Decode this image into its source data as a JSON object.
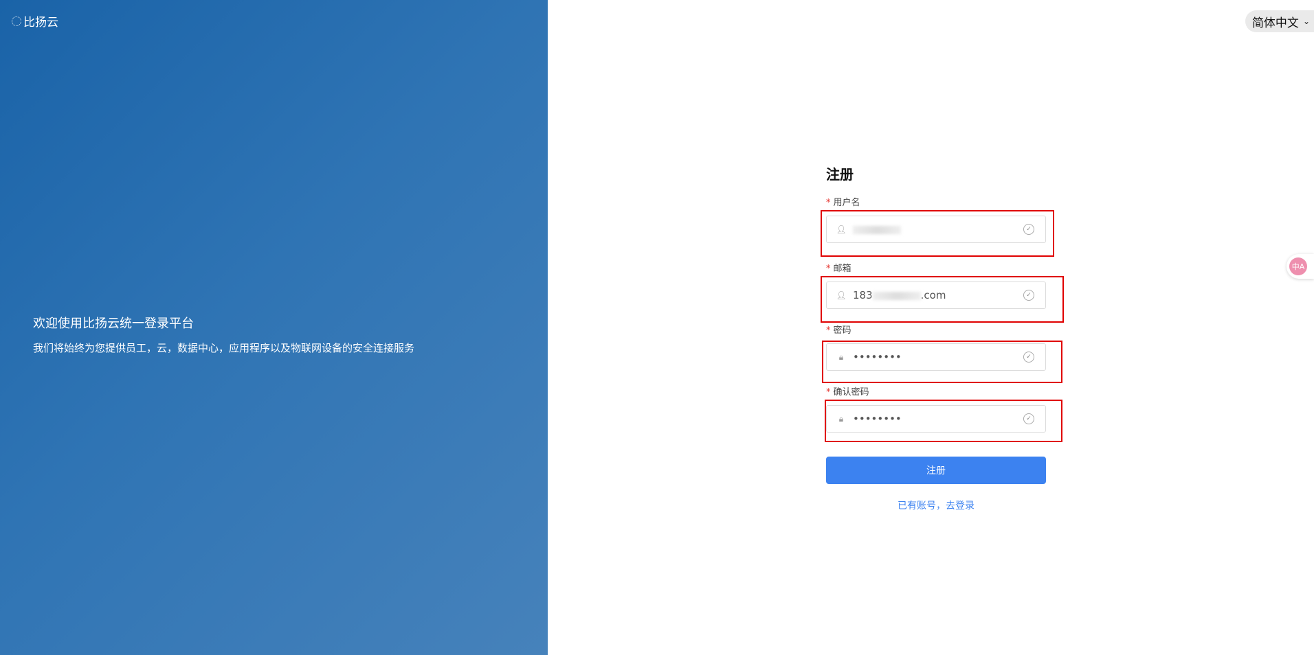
{
  "brand": {
    "name": "比扬云",
    "icon": "loading-dots-icon"
  },
  "hero": {
    "title": "欢迎使用比扬云统一登录平台",
    "subtitle": "我们将始终为您提供员工，云，数据中心，应用程序以及物联网设备的安全连接服务"
  },
  "language": {
    "selected": "简体中文"
  },
  "translate_widget": {
    "icon": "translate-icon",
    "text": "中A"
  },
  "form": {
    "title": "注册",
    "required_mark": "*",
    "fields": [
      {
        "label": "用户名",
        "value": "",
        "icon": "user-icon"
      },
      {
        "label": "邮箱",
        "value_prefix": "183",
        "value_suffix": ".com",
        "icon": "user-icon"
      },
      {
        "label": "密码",
        "value": "••••••••",
        "icon": "lock-icon"
      },
      {
        "label": "确认密码",
        "value": "••••••••",
        "icon": "lock-icon"
      }
    ],
    "submit_label": "注册",
    "login_link": "已有账号，去登录"
  },
  "colors": {
    "primary": "#3c82f0",
    "highlight": "#e00000",
    "required": "#e5322d",
    "left_gradient_start": "#1a63a8",
    "left_gradient_end": "#4682bb"
  }
}
